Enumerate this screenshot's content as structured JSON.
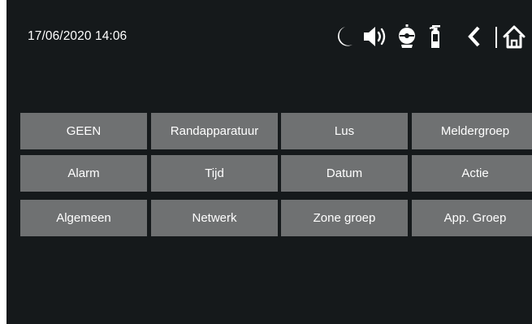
{
  "status": {
    "datetime": "17/06/2020 14:06",
    "icons": [
      "moon-icon",
      "speaker-icon",
      "fire-bell-icon",
      "fire-extinguisher-icon",
      "back-arrow-icon",
      "home-icon"
    ]
  },
  "menu": {
    "rows": [
      [
        "GEEN",
        "Randapparatuur",
        "Lus",
        "Meldergroep"
      ],
      [
        "Alarm",
        "Tijd",
        "Datum",
        "Actie"
      ],
      [
        "Algemeen",
        "Netwerk",
        "Zone groep",
        "App. Groep"
      ]
    ]
  },
  "colors": {
    "background": "#15191b",
    "button": "#6f7172",
    "text": "#ffffff"
  }
}
